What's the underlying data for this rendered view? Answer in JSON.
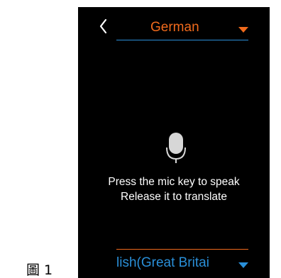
{
  "caption": "圖 1",
  "header": {
    "back_icon": "chevron-left-icon",
    "source_language": "German"
  },
  "main": {
    "mic_icon": "microphone-icon",
    "instruction_line1": "Press the mic key to speak",
    "instruction_line2": "Release it to translate"
  },
  "footer": {
    "target_language": "lish(Great Britai",
    "flag_icon": "globe-icon"
  },
  "colors": {
    "background": "#000000",
    "source_accent": "#f06a1c",
    "target_accent": "#2a8fd8",
    "text": "#ffffff"
  }
}
